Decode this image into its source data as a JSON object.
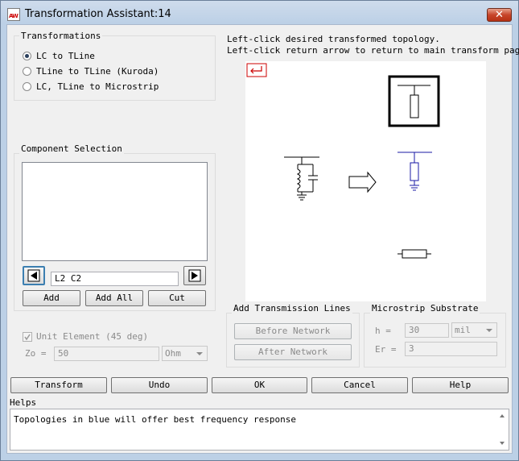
{
  "window": {
    "title": "Transformation Assistant:14",
    "icon_text": "AW"
  },
  "transformations": {
    "group_title": "Transformations",
    "options": [
      {
        "label": "LC to TLine",
        "selected": true
      },
      {
        "label": "TLine to TLine (Kuroda)",
        "selected": false
      },
      {
        "label": "LC, TLine to Microstrip",
        "selected": false
      }
    ]
  },
  "instructions": {
    "line1": "Left-click desired transformed topology.",
    "line2": "Left-click return arrow to return to main transform page."
  },
  "component_selection": {
    "group_title": "Component Selection",
    "list_items": [],
    "current_value": "L2 C2",
    "add_label": "Add",
    "add_all_label": "Add All",
    "cut_label": "Cut"
  },
  "unit_element": {
    "checkbox_label": "Unit Element (45 deg)",
    "checked": true,
    "zo_label": "Zo =",
    "zo_value": "50",
    "zo_unit": "Ohm"
  },
  "add_transmission_lines": {
    "group_title": "Add Transmission Lines",
    "before_label": "Before Network",
    "after_label": "After Network"
  },
  "microstrip_substrate": {
    "group_title": "Microstrip Substrate",
    "h_label": "h =",
    "h_value": "30",
    "h_unit": "mil",
    "er_label": "Er =",
    "er_value": "3"
  },
  "bottom_buttons": {
    "transform": "Transform",
    "undo": "Undo",
    "ok": "OK",
    "cancel": "Cancel",
    "help": "Help"
  },
  "helps": {
    "label": "Helps",
    "text": "Topologies in blue will offer best frequency response"
  },
  "colors": {
    "return_arrow": "#cc0000",
    "best_topology": "#1a1aa6",
    "close_button": "#c7452a"
  },
  "icons": [
    "app-icon",
    "close-icon",
    "return-arrow-icon",
    "left-arrow-icon",
    "right-arrow-icon",
    "scroll-up-icon",
    "scroll-down-icon"
  ]
}
